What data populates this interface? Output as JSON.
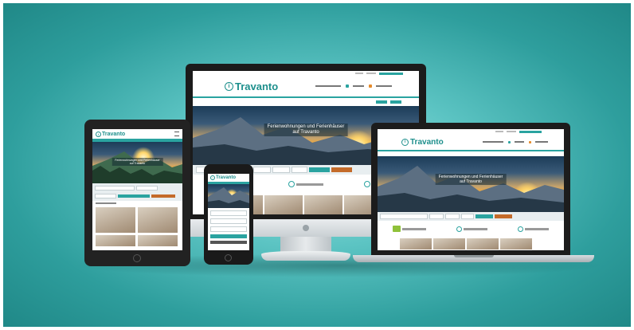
{
  "brand": {
    "name": "Travanto",
    "logo_icon": "info-circle-icon",
    "accent": "#2aa3a0",
    "accent_dark": "#1d8f8c",
    "cta_orange": "#c46b2a"
  },
  "hero": {
    "headline_line1": "Ferienwohnungen und Ferienhäuser",
    "headline_line2": "auf Travanto"
  },
  "devices": [
    "monitor",
    "laptop",
    "tablet",
    "phone"
  ]
}
